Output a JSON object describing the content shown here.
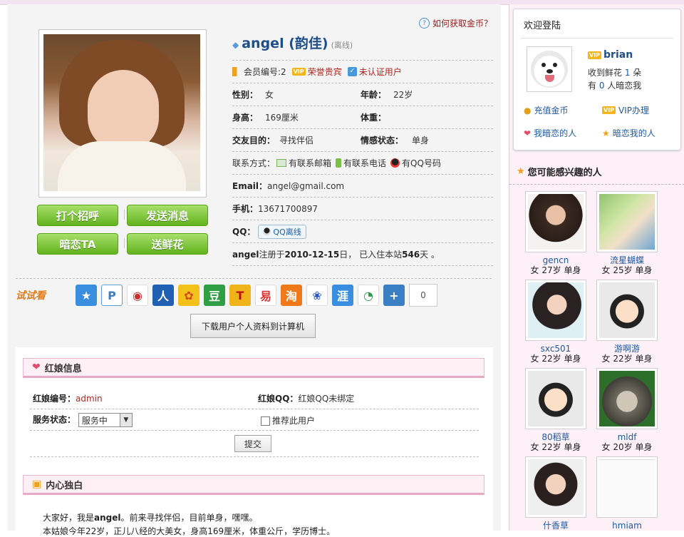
{
  "header": {
    "gold_link": "如何获取金币？"
  },
  "profile": {
    "name": "angel (韵佳)",
    "status": "(离线)",
    "member_no": "会员编号:2",
    "vip_label": "荣誉贵宾",
    "verify_label": "未认证用户",
    "gender_label": "性别：",
    "gender": "女",
    "age_label": "年龄：",
    "age": "22岁",
    "height_label": "身高：",
    "height": "169厘米",
    "weight_label": "体重：",
    "weight": "",
    "purpose_label": "交友目的：",
    "purpose": "寻找伴侣",
    "relationship_label": "情感状态：",
    "relationship": "单身",
    "contact_label": "联系方式：",
    "contact_email": "有联系邮箱",
    "contact_phone": "有联系电话",
    "contact_qq": "有QQ号码",
    "email_label": "Email：",
    "email": "angel@gmail.com",
    "mobile_label": "手机：",
    "mobile": "13671700897",
    "qq_label": "QQ：",
    "qq_status": "QQ离线",
    "reg_user": "angel",
    "reg_text1": " 注册于 ",
    "reg_date": "2010-12-15",
    "reg_text2": " 日， 已入住本站 ",
    "reg_days": "546",
    "reg_text3": " 天 。"
  },
  "actions": {
    "greet": "打个招呼",
    "message": "发送消息",
    "crush": "暗恋TA",
    "flower": "送鲜花"
  },
  "share": {
    "try_label": "试试看",
    "count": "0",
    "download": "下载用户个人资料到计算机"
  },
  "matchmaker": {
    "title": "红娘信息",
    "id_label": "红娘编号：",
    "id": "admin",
    "qq_label": "红娘QQ：",
    "qq": "红娘QQ未绑定",
    "service_label": "服务状态：",
    "service_value": "服务中",
    "recommend_label": "推荐此用户",
    "submit": "提交"
  },
  "monologue": {
    "title": "内心独白",
    "line1_a": "大家好，我是",
    "line1_b": "angel",
    "line1_c": "。前来寻找伴侣，目前单身，嘿嘿。",
    "line2": "本姑娘今年22岁，正儿八经的大美女，身高169厘米，体重公斤，学历博士。"
  },
  "sidebar": {
    "welcome_title": "欢迎登陆",
    "username": "brian",
    "flowers_pre": "收到鲜花 ",
    "flowers": "1",
    "flowers_post": " 朵",
    "crush_pre": "有 ",
    "crush": "0",
    "crush_post": " 人暗恋我",
    "recharge": "充值金币",
    "vip": "VIP办理",
    "my_crush": "我暗恋的人",
    "crush_me": "暗恋我的人",
    "interest_title": "您可能感兴趣的人",
    "people": [
      {
        "name": "gencn",
        "meta": "女 27岁 单身"
      },
      {
        "name": "流星蝴蝶",
        "meta": "女 25岁 单身"
      },
      {
        "name": "sxc501",
        "meta": "女 22岁 单身"
      },
      {
        "name": "游啊游",
        "meta": "女 22岁 单身"
      },
      {
        "name": "80稻草",
        "meta": "女 22岁 单身"
      },
      {
        "name": "mldf",
        "meta": "女 20岁 单身"
      },
      {
        "name": "什香草",
        "meta": ""
      },
      {
        "name": "hmiam",
        "meta": ""
      }
    ]
  },
  "colors": {
    "accent_blue": "#1e4f8a",
    "green_button": "#62b21e",
    "pink_panel": "#fdf0f7"
  }
}
